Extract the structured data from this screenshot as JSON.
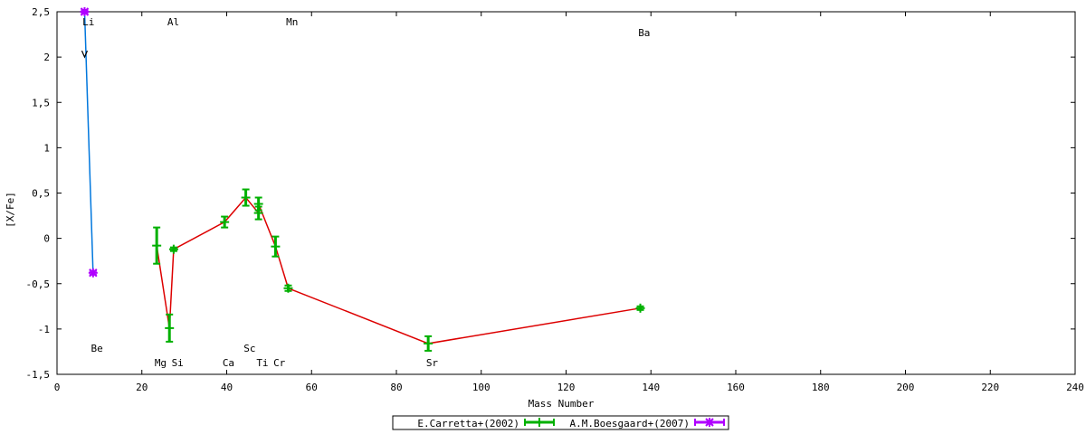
{
  "chart_data": {
    "type": "line",
    "title": "",
    "xlabel": "Mass Number",
    "ylabel": "[X/Fe]",
    "xlim": [
      0,
      240
    ],
    "ylim": [
      -1.5,
      2.5
    ],
    "xticks": [
      "0",
      "20",
      "40",
      "60",
      "80",
      "100",
      "120",
      "140",
      "160",
      "180",
      "200",
      "220",
      "240"
    ],
    "yticks": [
      "-1.5",
      "-1",
      "-0.5",
      "0",
      "0.5",
      "1",
      "1.5",
      "2",
      "2.5"
    ],
    "grid": false,
    "legend_placement": "bottom-center",
    "series": [
      {
        "name": "E.Carretta+(2002)",
        "color": "#00b000",
        "line_color": "#dd0000",
        "points": [
          {
            "x": 23.5,
            "y": -0.08,
            "err": 0.2
          },
          {
            "x": 26.5,
            "y": -0.99,
            "err": 0.15
          },
          {
            "x": 27.5,
            "y": -0.12,
            "err": 0.02
          },
          {
            "x": 39.5,
            "y": 0.18,
            "err": 0.06
          },
          {
            "x": 44.5,
            "y": 0.45,
            "err": 0.09
          },
          {
            "x": 47.5,
            "y": 0.28,
            "err": 0.07
          },
          {
            "x": 47.5,
            "y": 0.38,
            "err": 0.07
          },
          {
            "x": 51.5,
            "y": -0.09,
            "err": 0.11
          },
          {
            "x": 54.5,
            "y": -0.55,
            "err": 0.03
          },
          {
            "x": 87.5,
            "y": -1.16,
            "err": 0.08
          },
          {
            "x": 137.5,
            "y": -0.77,
            "err": 0.02
          }
        ]
      },
      {
        "name": "A.M.Boesgaard+(2007)",
        "color": "#b000ff",
        "line_color": "#0077dd",
        "points": [
          {
            "x": 6.5,
            "y": 2.5,
            "err": 0.02
          },
          {
            "x": 8.5,
            "y": -0.38,
            "err": 0.02
          }
        ]
      }
    ],
    "annotations": [
      {
        "text": "Li",
        "x": 6,
        "y": 2.35
      },
      {
        "text": "Be",
        "x": 8,
        "y": -1.25
      },
      {
        "text": "Mg",
        "x": 23,
        "y": -1.41
      },
      {
        "text": "Al",
        "x": 26,
        "y": 2.35
      },
      {
        "text": "Si",
        "x": 27,
        "y": -1.41
      },
      {
        "text": "Ca",
        "x": 39,
        "y": -1.41
      },
      {
        "text": "Sc",
        "x": 44,
        "y": -1.25
      },
      {
        "text": "Ti",
        "x": 47,
        "y": -1.41
      },
      {
        "text": "Cr",
        "x": 51,
        "y": -1.41
      },
      {
        "text": "Mn",
        "x": 54,
        "y": 2.35
      },
      {
        "text": "Sr",
        "x": 87,
        "y": -1.41
      },
      {
        "text": "Ba",
        "x": 137,
        "y": 2.23
      }
    ]
  }
}
